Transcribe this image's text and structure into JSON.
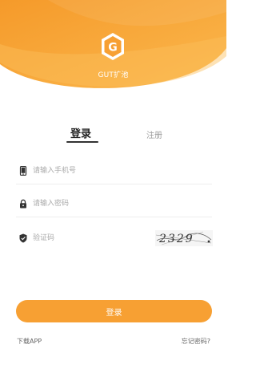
{
  "header": {
    "app_name": "GUT扩池",
    "logo_letter": "G",
    "logo_icon": "hexagon-g-logo"
  },
  "tabs": {
    "login": "登录",
    "register": "注册"
  },
  "form": {
    "phone": {
      "placeholder": "请输入手机号",
      "value": "",
      "icon": "phone-icon"
    },
    "password": {
      "placeholder": "请输入密码",
      "value": "",
      "icon": "lock-icon"
    },
    "captcha": {
      "placeholder": "验证码",
      "value": "",
      "icon": "shield-icon",
      "image_text": "2329"
    }
  },
  "actions": {
    "login_label": "登录",
    "download_label": "下载APP",
    "forgot_label": "忘记密码?"
  },
  "colors": {
    "accent": "#f7a033",
    "header_gradient_start": "#f6a02f",
    "header_gradient_end": "#fbc05a"
  }
}
